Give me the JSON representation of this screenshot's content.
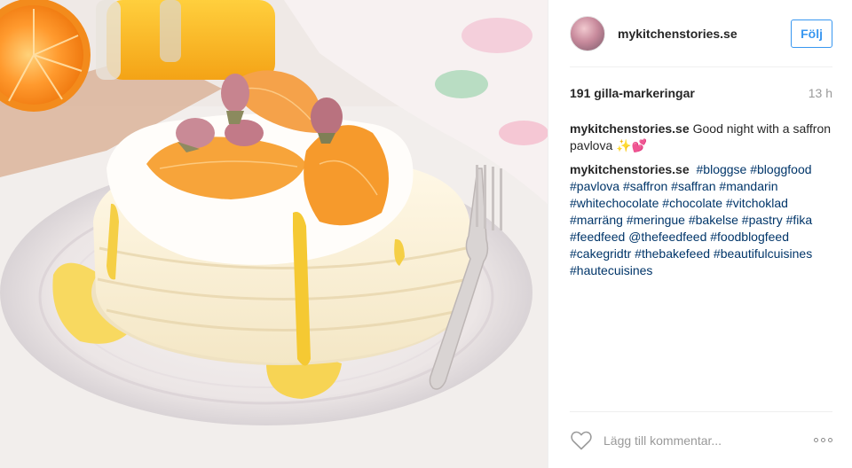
{
  "header": {
    "username": "mykitchenstories.se",
    "follow_label": "Följ"
  },
  "meta": {
    "likes": "191 gilla-markeringar",
    "time": "13 h"
  },
  "caption": {
    "author": "mykitchenstories.se",
    "text": "Good night with a saffron pavlova",
    "emoji": "✨💕"
  },
  "tags_comment": {
    "author": "mykitchenstories.se",
    "tags": [
      "#bloggse",
      "#bloggfood",
      "#pavlova",
      "#saffron",
      "#saffran",
      "#mandarin",
      "#whitechocolate",
      "#chocolate",
      "#vitchoklad",
      "#marräng",
      "#meringue",
      "#bakelse",
      "#pastry",
      "#fika",
      "#feedfeed",
      "@thefeedfeed",
      "#foodblogfeed",
      "#cakegridtr",
      "#thebakefeed",
      "#beautifulcuisines",
      "#hautecuisines"
    ]
  },
  "footer": {
    "comment_placeholder": "Lägg till kommentar..."
  },
  "icons": {
    "like": "heart-outline-icon",
    "more": "more-options-icon"
  },
  "colors": {
    "accent": "#3897f0",
    "tag": "#003569",
    "muted": "#999999"
  }
}
